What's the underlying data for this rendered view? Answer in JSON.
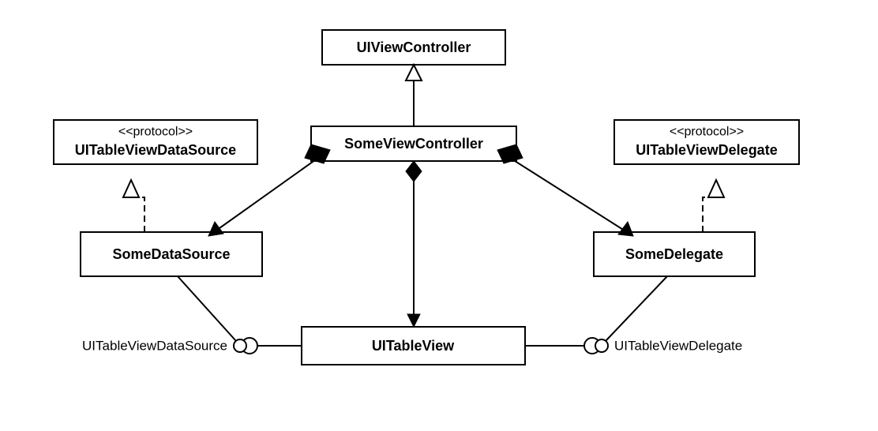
{
  "nodes": {
    "uiViewController": {
      "label": "UIViewController"
    },
    "someViewController": {
      "label": "SomeViewController"
    },
    "protocolDataSource": {
      "stereotype": "<<protocol>>",
      "label": "UITableViewDataSource"
    },
    "protocolDelegate": {
      "stereotype": "<<protocol>>",
      "label": "UITableViewDelegate"
    },
    "someDataSource": {
      "label": "SomeDataSource"
    },
    "someDelegate": {
      "label": "SomeDelegate"
    },
    "uiTableView": {
      "label": "UITableView"
    }
  },
  "ports": {
    "dataSourcePort": {
      "label": "UITableViewDataSource"
    },
    "delegatePort": {
      "label": "UITableViewDelegate"
    }
  },
  "chart_data": {
    "type": "diagram",
    "diagram_kind": "UML class diagram",
    "classes": [
      {
        "id": "UIViewController",
        "stereotype": null
      },
      {
        "id": "SomeViewController",
        "stereotype": null
      },
      {
        "id": "UITableViewDataSource",
        "stereotype": "protocol"
      },
      {
        "id": "UITableViewDelegate",
        "stereotype": "protocol"
      },
      {
        "id": "SomeDataSource",
        "stereotype": null
      },
      {
        "id": "SomeDelegate",
        "stereotype": null
      },
      {
        "id": "UITableView",
        "stereotype": null
      }
    ],
    "relationships": [
      {
        "from": "SomeViewController",
        "to": "UIViewController",
        "type": "generalization"
      },
      {
        "from": "SomeDataSource",
        "to": "UITableViewDataSource",
        "type": "realization"
      },
      {
        "from": "SomeDelegate",
        "to": "UITableViewDelegate",
        "type": "realization"
      },
      {
        "from": "SomeViewController",
        "to": "SomeDataSource",
        "type": "composition"
      },
      {
        "from": "SomeViewController",
        "to": "SomeDelegate",
        "type": "composition"
      },
      {
        "from": "SomeViewController",
        "to": "UITableView",
        "type": "composition"
      },
      {
        "from": "UITableView",
        "to": "SomeDataSource",
        "type": "required-interface",
        "interface": "UITableViewDataSource"
      },
      {
        "from": "UITableView",
        "to": "SomeDelegate",
        "type": "required-interface",
        "interface": "UITableViewDelegate"
      }
    ]
  }
}
